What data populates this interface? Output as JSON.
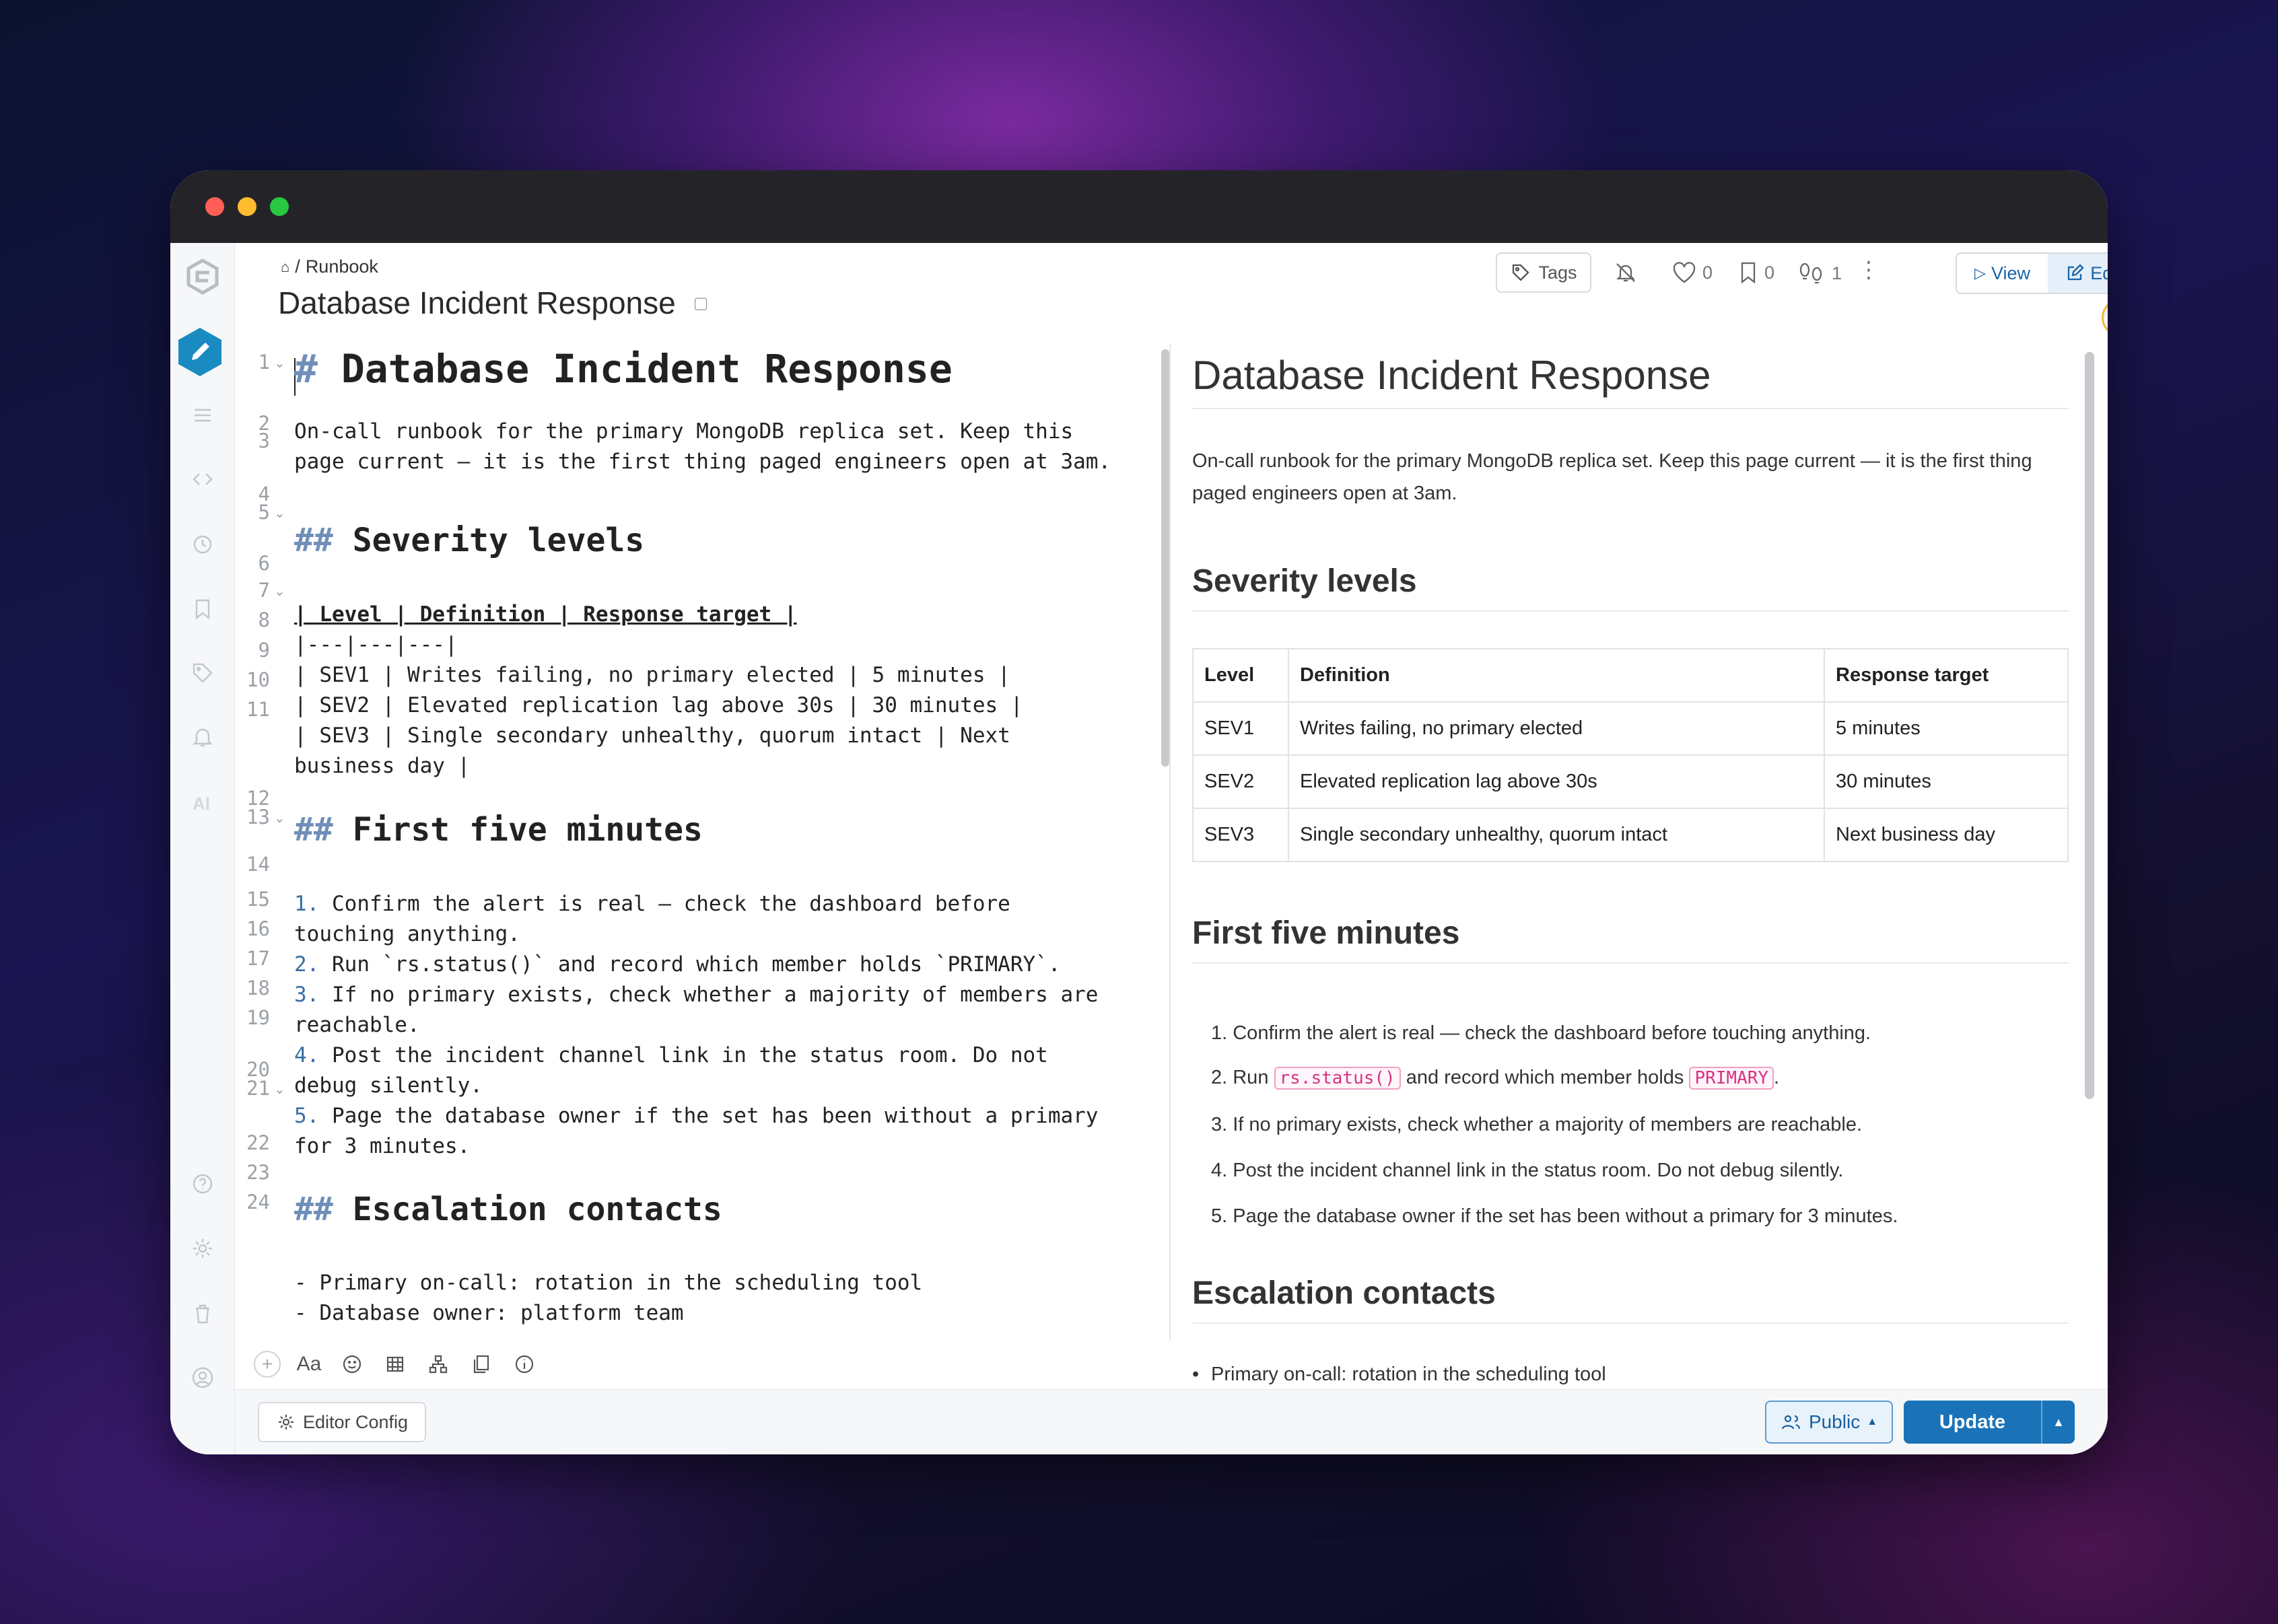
{
  "breadcrumb": {
    "home_icon": "home-icon",
    "separator": "/",
    "label": "Runbook"
  },
  "page_title": "Database Incident Response",
  "toolbar": {
    "tags_label": "Tags",
    "likes_count": "0",
    "bookmarks_count": "0",
    "seen_count": "1",
    "view_label": "View",
    "edit_label": "Edit"
  },
  "editor": {
    "lines": [
      {
        "n": "1",
        "fold": true
      },
      {
        "n": "2"
      },
      {
        "n": "3"
      },
      {
        "n": "4"
      },
      {
        "n": "5",
        "fold": true
      },
      {
        "n": "6"
      },
      {
        "n": "7",
        "fold": true
      },
      {
        "n": "8"
      },
      {
        "n": "9"
      },
      {
        "n": "10"
      },
      {
        "n": "11"
      },
      {
        "n": "12"
      },
      {
        "n": "13",
        "fold": true
      },
      {
        "n": "14"
      },
      {
        "n": "15"
      },
      {
        "n": "16"
      },
      {
        "n": "17"
      },
      {
        "n": "18"
      },
      {
        "n": "19"
      },
      {
        "n": "20"
      },
      {
        "n": "21",
        "fold": true
      },
      {
        "n": "22"
      },
      {
        "n": "23"
      },
      {
        "n": "24"
      }
    ],
    "h1_hash": "#",
    "h1_text": " Database Incident Response",
    "intro_1": "On-call runbook for the primary MongoDB replica set. Keep this",
    "intro_2": "page current — it is the first thing paged engineers open at 3am.",
    "h2_hash": "##",
    "h2_severity": " Severity levels",
    "table_header": "| Level | Definition | Response target |",
    "table_sep": "|---|---|---|",
    "table_row1": "| SEV1 | Writes failing, no primary elected | 5 minutes |",
    "table_row2": "| SEV2 | Elevated replication lag above 30s | 30 minutes |",
    "table_row3a": "| SEV3 | Single secondary unhealthy, quorum intact | Next",
    "table_row3b": "business day |",
    "h2_first": " First five minutes",
    "step1_num": "1.",
    "step1a": " Confirm the alert is real — check the dashboard before",
    "step1b": "touching anything.",
    "step2_num": "2.",
    "step2": " Run `rs.status()` and record which member holds `PRIMARY`.",
    "step3_num": "3.",
    "step3a": " If no primary exists, check whether a majority of members are",
    "step3b": "reachable.",
    "step4_num": "4.",
    "step4a": " Post the incident channel link in the status room. Do not",
    "step4b": "debug silently.",
    "step5_num": "5.",
    "step5a": " Page the database owner if the set has been without a primary",
    "step5b": "for 3 minutes.",
    "h2_escalation": " Escalation contacts",
    "bullet1": "- Primary on-call: rotation in the scheduling tool",
    "bullet2": "- Database owner: platform team"
  },
  "editor_toolbar": {
    "font_label": "Aa"
  },
  "preview": {
    "h1": "Database Incident Response",
    "intro": "On-call runbook for the primary MongoDB replica set. Keep this page current — it is the first thing paged engineers open at 3am.",
    "h2_severity": "Severity levels",
    "table": {
      "headers": [
        "Level",
        "Definition",
        "Response target"
      ],
      "rows": [
        [
          "SEV1",
          "Writes failing, no primary elected",
          "5 minutes"
        ],
        [
          "SEV2",
          "Elevated replication lag above 30s",
          "30 minutes"
        ],
        [
          "SEV3",
          "Single secondary unhealthy, quorum intact",
          "Next business day"
        ]
      ]
    },
    "h2_first": "First five minutes",
    "steps": {
      "s1": "1. Confirm the alert is real — check the dashboard before touching anything.",
      "s2_pre": "2. Run ",
      "s2_code1": "rs.status()",
      "s2_mid": " and record which member holds ",
      "s2_code2": "PRIMARY",
      "s2_post": ".",
      "s3": "3. If no primary exists, check whether a majority of members are reachable.",
      "s4": "4. Post the incident channel link in the status room. Do not debug silently.",
      "s5": "5. Page the database owner if the set has been without a primary for 3 minutes."
    },
    "h2_escalation": "Escalation contacts",
    "bullet1": "Primary on-call: rotation in the scheduling tool",
    "bullet_mark": "•"
  },
  "footer": {
    "editor_config_label": "Editor Config",
    "public_label": "Public",
    "update_label": "Update"
  },
  "colors": {
    "accent": "#1a73b8",
    "code_pink": "#d63384",
    "sidebar_active": "#1a8bc0"
  }
}
